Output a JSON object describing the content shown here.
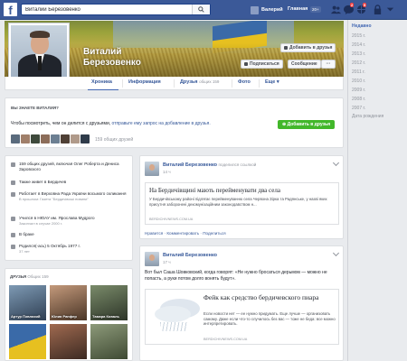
{
  "topbar": {
    "search_value": "Виталий Березовенко",
    "user_name": "Валерий",
    "home_label": "Главная",
    "home_count": "20+",
    "notif_badge_1": "2",
    "notif_badge_2": "5"
  },
  "profile": {
    "name_line1": "Виталий",
    "name_line2": "Березовенко",
    "add_friend_label": "Добавить в друзья",
    "subscribe_label": "Подписаться",
    "message_label": "Сообщение",
    "more_label": "···"
  },
  "tabs": [
    {
      "label": "Хроника"
    },
    {
      "label": "Информация"
    },
    {
      "label": "Друзья",
      "count": "общих 159"
    },
    {
      "label": "Фото"
    },
    {
      "label": "Еще ▾"
    }
  ],
  "years": [
    "Недавно",
    "2015 г.",
    "2014 г.",
    "2013 г.",
    "2012 г.",
    "2011 г.",
    "2010 г.",
    "2009 г.",
    "2008 г.",
    "2007 г.",
    "Дата рождения"
  ],
  "suggest": {
    "title": "ВЫ ЗНАЕТЕ ВИТАЛИЯ?",
    "text_prefix": "Чтобы посмотреть, чем он делится с друзьями,",
    "text_link": "отправьте ему запрос на добавление в друзья.",
    "button": "Добавить в друзья",
    "mutual": "159 общих друзей"
  },
  "intro": {
    "mutual": "159 общих друзей, включая Олег Роберта и Дениса Заровского",
    "lives": "Также живет в Бердичев",
    "work": "Работает в Верховна Рада України восьмого скликання",
    "work_sub": "В прошлом: Газета \"Бердичівські новини\"",
    "study": "Учился в НЮАУ им. Ярослава Мудрого",
    "study_sub": "Закончил в случае 2000 г.",
    "married": "В браке",
    "born": "Родился(-ась) 5 Октябрь 1977 г.",
    "age": "37 лет"
  },
  "friends_box": {
    "title": "ДРУЗЬЯ",
    "count": "Общих 159",
    "names": [
      "Артур Пэвлахий",
      "Юлия Рапфер",
      "Тамара Коваль",
      "",
      "",
      ""
    ]
  },
  "post1": {
    "author": "Виталий Березовенко",
    "action": "поделился ссылкой",
    "time": "14 ч",
    "link_title": "На Бердичівщині мають перейменувати два села",
    "link_desc": "У Бердичівському районі підлягає перейменуванню села Червона Зірка та Радянське, у назві яких присутня заборонені декомунізаційним законодавством н...",
    "domain": "BERDICHIVNEWS.COM.UA",
    "actions": "Нравится · Комментировать · Поделиться"
  },
  "post2": {
    "author": "Виталий Березовенко",
    "time": "17 ч",
    "text": "Вот был Саша Шовковский, когда говорят: «Не нужно бросаться дерьмом — можно не попасть, а руки потом долго вонять будут».",
    "link_title": "Фейк как средство бердичевского пиара",
    "link_desc": "Если новости нет — ее нужно придумать. Еще лучше — организовать самому. Даже если что-то случилось без вас — тоже не беда: все можно интерпретировать.",
    "domain": "BERDICHIVNEWS.COM.UA"
  },
  "colors": {
    "brand": "#3b5998",
    "link": "#365899",
    "green": "#42b72a"
  }
}
